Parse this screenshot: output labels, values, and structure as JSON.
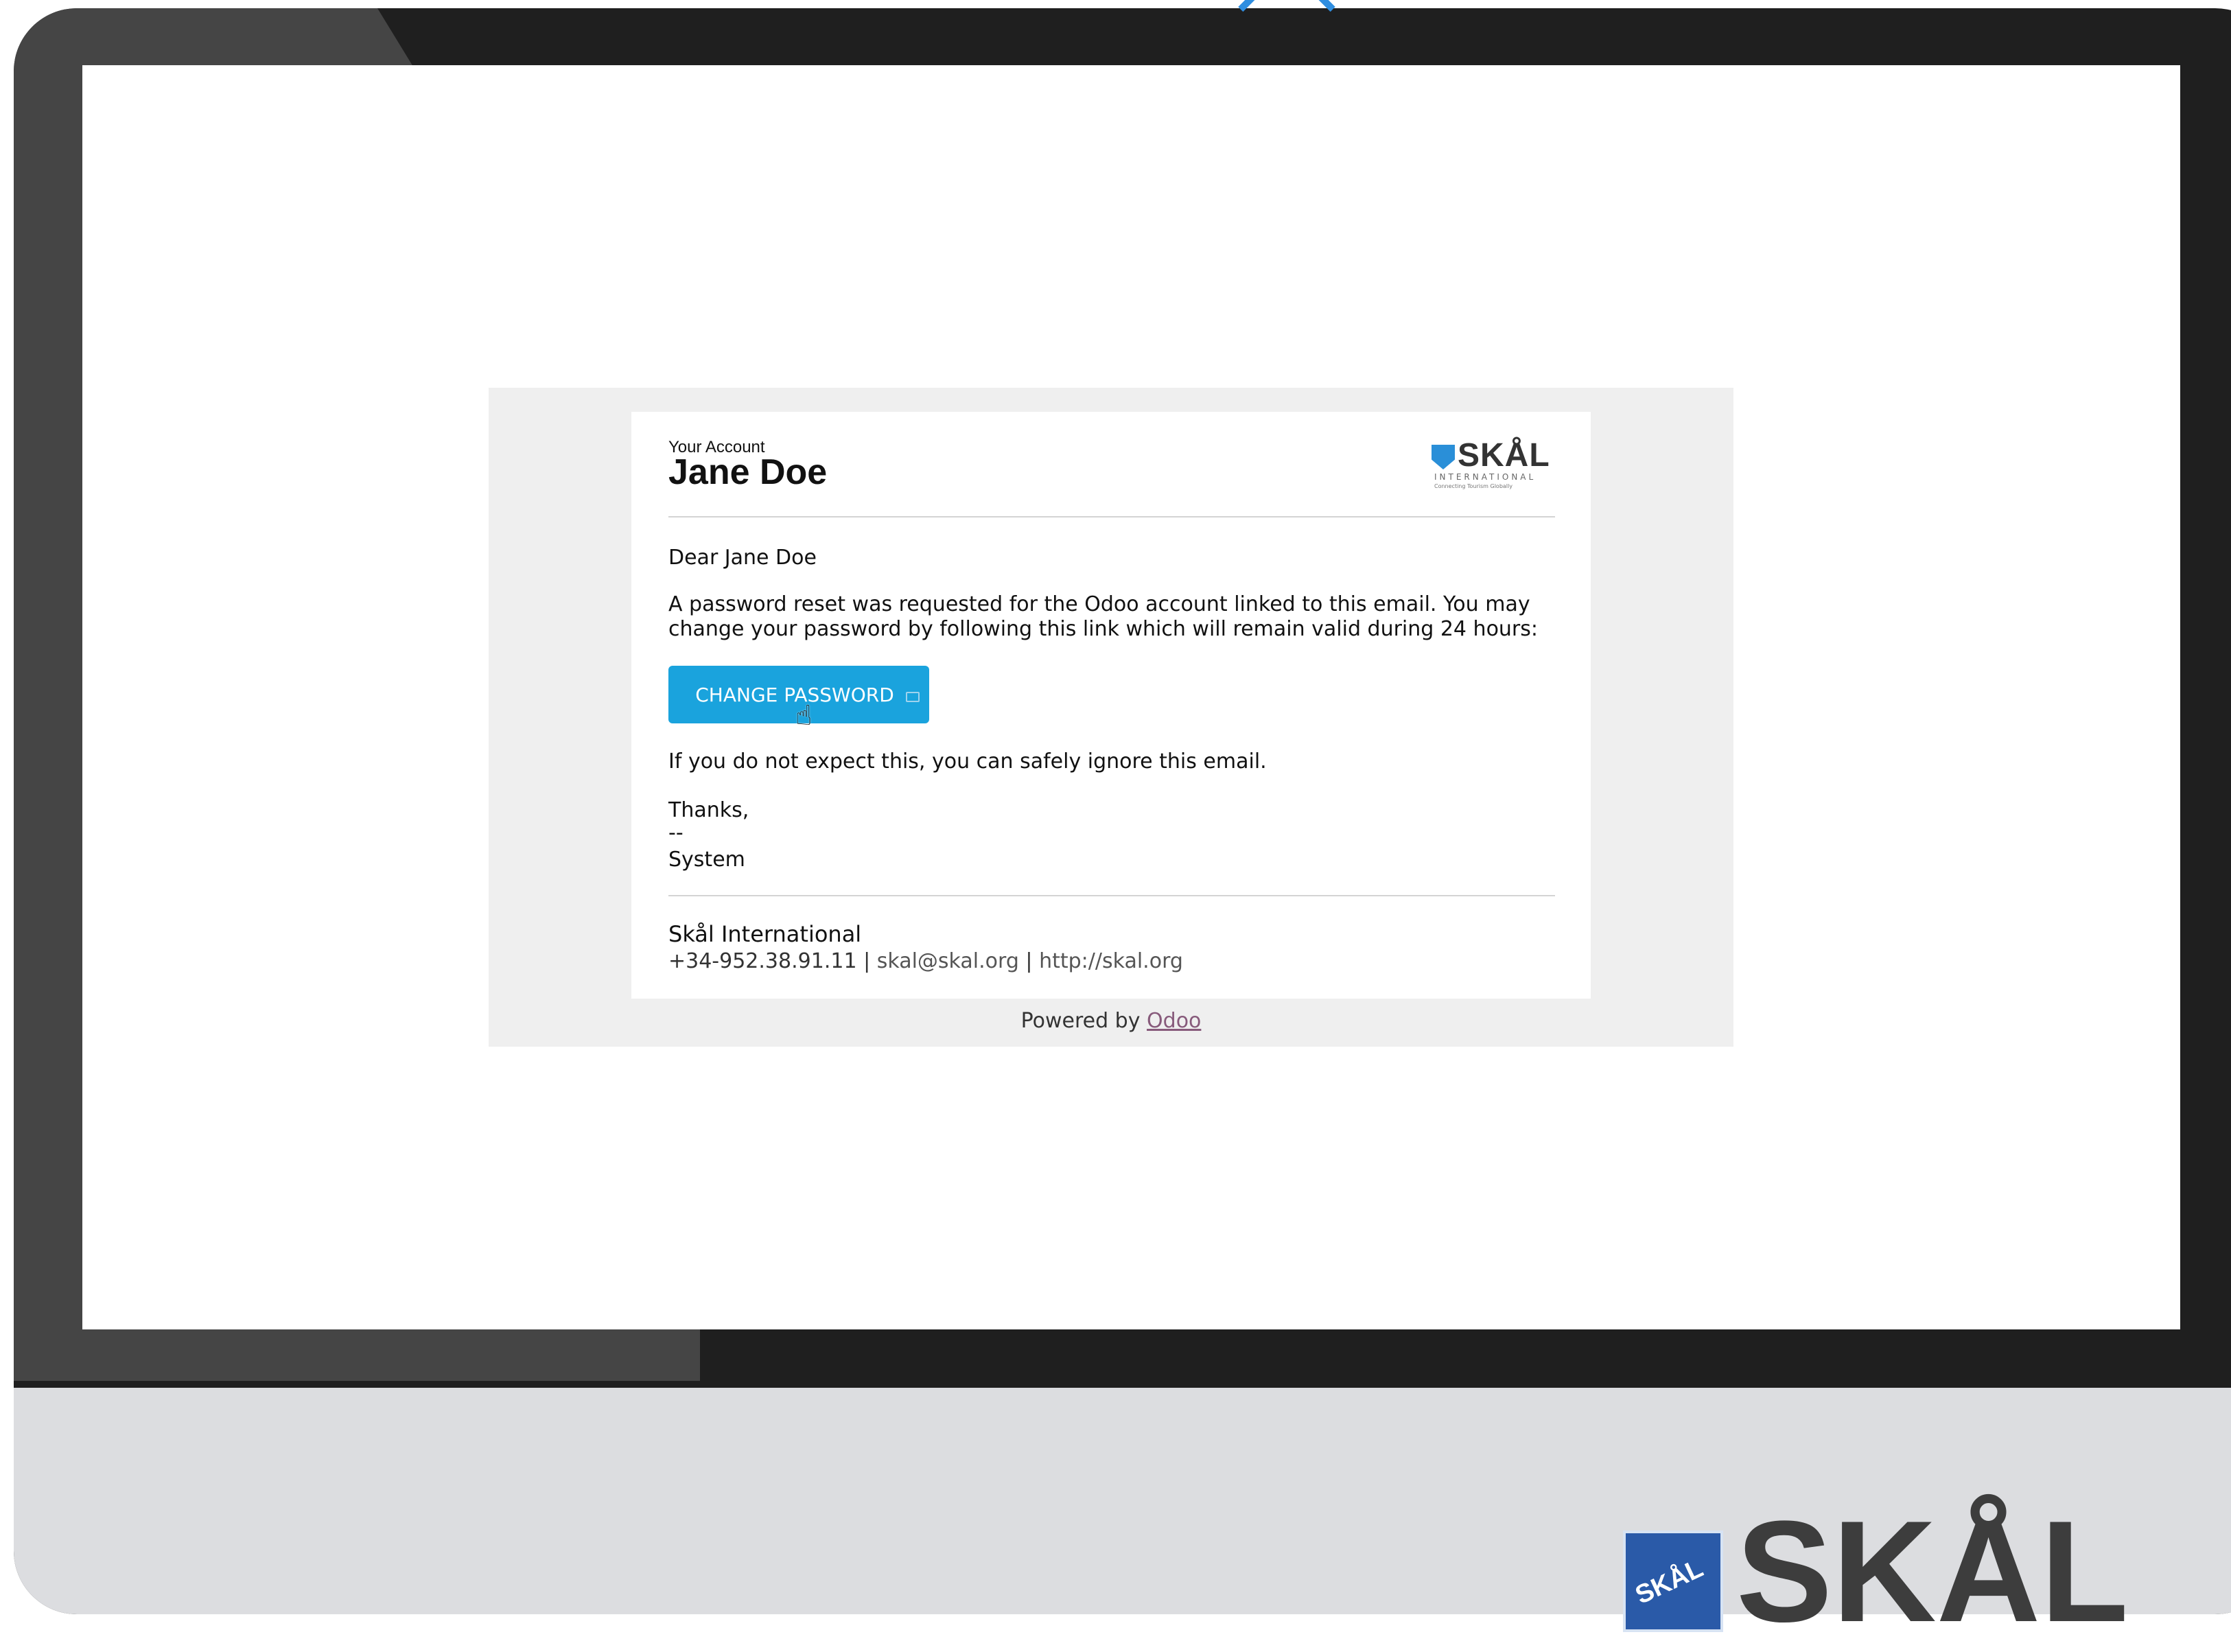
{
  "email": {
    "header_small": "Your Account",
    "header_name": "Jane Doe",
    "logo": {
      "word": "SKÅL",
      "sub": "INTERNATIONAL",
      "tagline": "Connecting Tourism Globally"
    },
    "greeting": "Dear Jane Doe",
    "body_line_1": "A password reset was requested for the Odoo account linked to this email. You may",
    "body_line_2": "change your password by following this link which will remain valid during 24 hours:",
    "button_label": "CHANGE PASSWORD",
    "ignore_text": "If you do not expect this, you can safely ignore this email.",
    "signoff_thanks": "Thanks,",
    "signoff_dash": "--",
    "signoff_name": "System",
    "footer": {
      "company": "Skål International",
      "phone": "+34-952.38.91.11",
      "separator": "|",
      "email": "skal@skal.org",
      "website": "http://skal.org"
    },
    "powered_by": "Powered by",
    "powered_link": "Odoo"
  },
  "bottom_logo": {
    "badge_text": "SKÅL",
    "word": "SKÅL"
  },
  "colors": {
    "button": "#1aa3dd",
    "odoo_link": "#875a7b",
    "bezel": "#1f1f1f",
    "chin": "#dcdde0"
  }
}
